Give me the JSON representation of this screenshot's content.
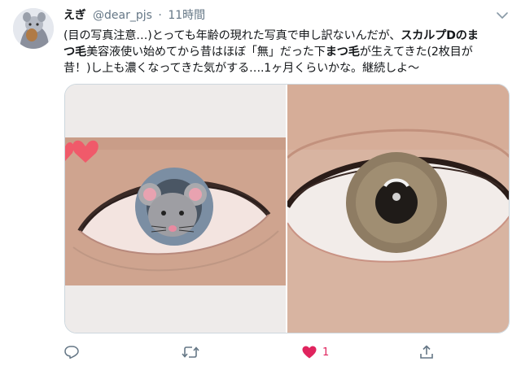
{
  "tweet": {
    "display_name": "えぎ",
    "handle": "@dear_pjs",
    "separator": "·",
    "timestamp": "11時間",
    "text_line1_a": "(目の写真注意…)とっても年齢の現れた写真で申し訳ないんだが、",
    "text_line1_bold": "スカルプDのま",
    "text_line2_bold": "つ毛",
    "text_line2_a": "美容液使い始めてから昔はほぼ「無」だった下",
    "text_line2_bold2": "まつ毛",
    "text_line2_b": "が生えてきた(2枚目が",
    "text_line3": "昔！)し上も濃くなってきた気がする….1ヶ月くらいかな。継続しよ〜"
  },
  "actions": {
    "like_count": "1"
  },
  "colors": {
    "like_red": "#e0245e",
    "icon_gray": "#657786",
    "border": "#ccd6dd"
  },
  "icons": [
    "reply-icon",
    "retweet-icon",
    "heart-icon",
    "share-icon",
    "caret-down-icon"
  ]
}
